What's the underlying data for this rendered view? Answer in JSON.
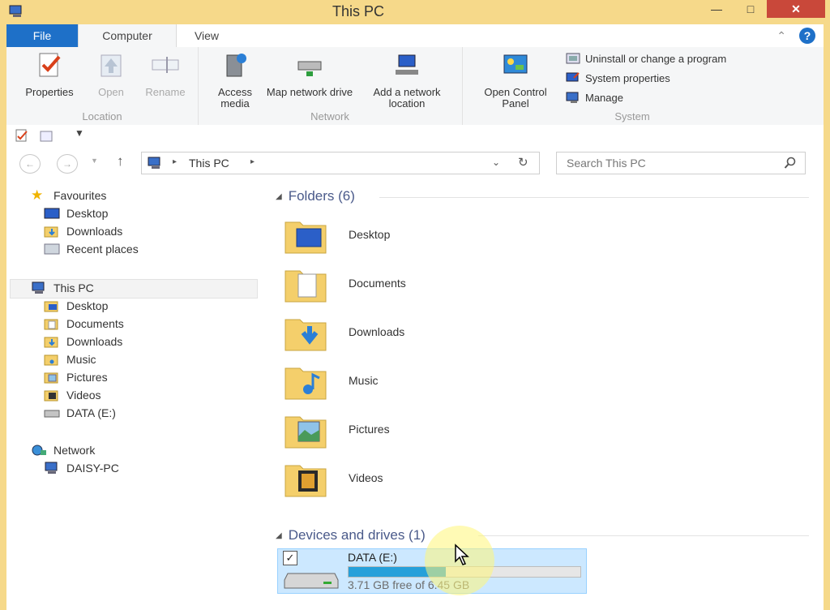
{
  "window": {
    "title": "This PC"
  },
  "ribbon_tabs": [
    "File",
    "Computer",
    "View"
  ],
  "ribbon": {
    "location": {
      "label": "Location",
      "properties": "Properties",
      "open": "Open",
      "rename": "Rename"
    },
    "network": {
      "label": "Network",
      "access_media": "Access media",
      "map_drive": "Map network drive",
      "add_location": "Add a network location"
    },
    "open_control_panel": "Open Control Panel",
    "system": {
      "label": "System",
      "uninstall": "Uninstall or change a program",
      "system_props": "System properties",
      "manage": "Manage"
    }
  },
  "address": {
    "crumb": "This PC",
    "search_placeholder": "Search This PC"
  },
  "nav": {
    "favourites": "Favourites",
    "fav_items": [
      "Desktop",
      "Downloads",
      "Recent places"
    ],
    "this_pc": "This PC",
    "pc_items": [
      "Desktop",
      "Documents",
      "Downloads",
      "Music",
      "Pictures",
      "Videos",
      "DATA (E:)"
    ],
    "network": "Network",
    "net_items": [
      "DAISY-PC"
    ]
  },
  "main": {
    "folders_heading": "Folders (6)",
    "folders": [
      "Desktop",
      "Documents",
      "Downloads",
      "Music",
      "Pictures",
      "Videos"
    ],
    "devices_heading": "Devices and drives (1)",
    "drive": {
      "name": "DATA (E:)",
      "free_text": "3.71 GB free of 6.45 GB",
      "used_fraction": 0.42
    }
  },
  "colors": {
    "accent": "#1e70c8",
    "close": "#c9483a",
    "selection": "#cce8ff",
    "bar": "#26a0da"
  }
}
